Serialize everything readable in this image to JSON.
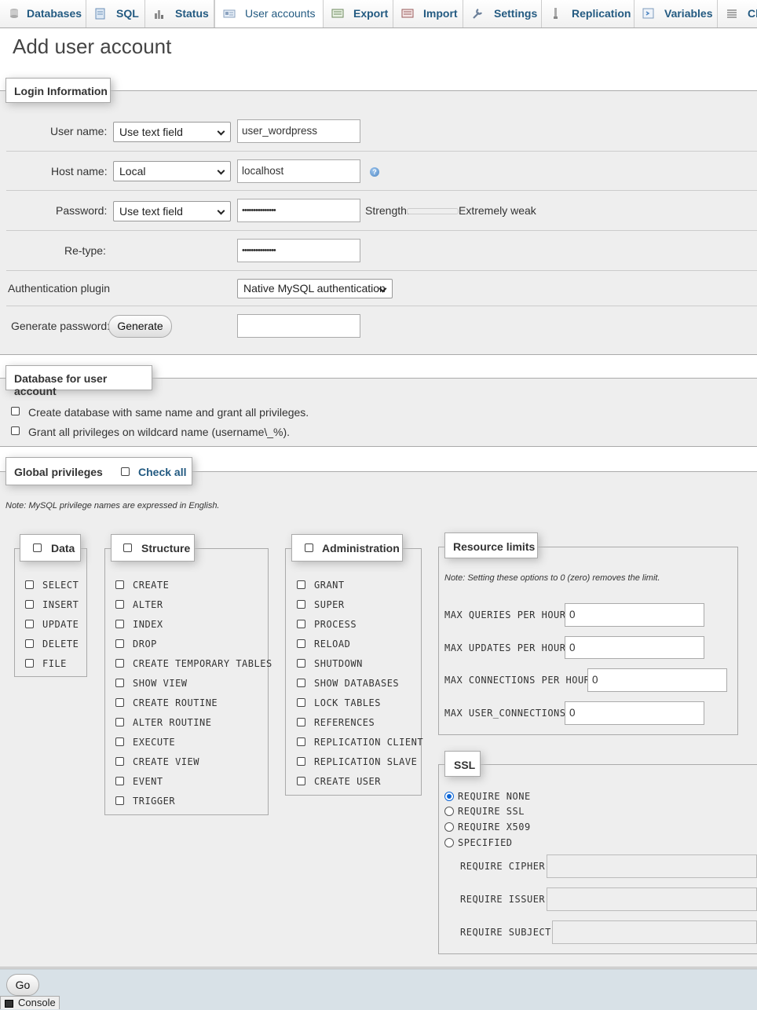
{
  "nav": {
    "tabs": [
      {
        "label": "Databases",
        "icon": "database-icon"
      },
      {
        "label": "SQL",
        "icon": "sql-icon"
      },
      {
        "label": "Status",
        "icon": "status-icon"
      },
      {
        "label": "User accounts",
        "icon": "user-accounts-icon",
        "active": true
      },
      {
        "label": "Export",
        "icon": "export-icon"
      },
      {
        "label": "Import",
        "icon": "import-icon"
      },
      {
        "label": "Settings",
        "icon": "wrench-icon"
      },
      {
        "label": "Replication",
        "icon": "replication-icon"
      },
      {
        "label": "Variables",
        "icon": "variables-icon"
      },
      {
        "label": "Ch",
        "icon": "charsets-icon"
      }
    ]
  },
  "page_title": "Add user account",
  "login": {
    "legend": "Login Information",
    "username_label": "User name:",
    "username_mode": "Use text field",
    "username_value": "user_wordpress",
    "host_label": "Host name:",
    "host_mode": "Local",
    "host_value": "localhost",
    "password_label": "Password:",
    "password_mode": "Use text field",
    "password_mask": "•••••••••••••••",
    "strength_label": "Strength:",
    "strength_value": "Extremely weak",
    "strength_level": 0,
    "retype_label": "Re-type:",
    "retype_mask": "•••••••••••••••",
    "auth_label": "Authentication plugin",
    "auth_value": "Native MySQL authentication",
    "generate_label": "Generate password:",
    "generate_button": "Generate",
    "generated_value": ""
  },
  "database": {
    "legend": "Database for user account",
    "options": [
      "Create database with same name and grant all privileges.",
      "Grant all privileges on wildcard name (username\\_%)."
    ]
  },
  "global": {
    "legend": "Global privileges",
    "check_all": "Check all",
    "note": "Note: MySQL privilege names are expressed in English.",
    "data": {
      "title": "Data",
      "items": [
        "SELECT",
        "INSERT",
        "UPDATE",
        "DELETE",
        "FILE"
      ]
    },
    "structure": {
      "title": "Structure",
      "items": [
        "CREATE",
        "ALTER",
        "INDEX",
        "DROP",
        "CREATE TEMPORARY TABLES",
        "SHOW VIEW",
        "CREATE ROUTINE",
        "ALTER ROUTINE",
        "EXECUTE",
        "CREATE VIEW",
        "EVENT",
        "TRIGGER"
      ]
    },
    "administration": {
      "title": "Administration",
      "items": [
        "GRANT",
        "SUPER",
        "PROCESS",
        "RELOAD",
        "SHUTDOWN",
        "SHOW DATABASES",
        "LOCK TABLES",
        "REFERENCES",
        "REPLICATION CLIENT",
        "REPLICATION SLAVE",
        "CREATE USER"
      ]
    },
    "resources": {
      "title": "Resource limits",
      "note": "Note: Setting these options to 0 (zero) removes the limit.",
      "rows": [
        {
          "label": "MAX QUERIES PER HOUR",
          "value": "0"
        },
        {
          "label": "MAX UPDATES PER HOUR",
          "value": "0"
        },
        {
          "label": "MAX CONNECTIONS PER HOUR",
          "value": "0"
        },
        {
          "label": "MAX USER_CONNECTIONS",
          "value": "0"
        }
      ]
    },
    "ssl": {
      "title": "SSL",
      "options": [
        "REQUIRE NONE",
        "REQUIRE SSL",
        "REQUIRE X509",
        "SPECIFIED"
      ],
      "selected": "REQUIRE NONE",
      "fields": [
        {
          "label": "REQUIRE CIPHER",
          "value": ""
        },
        {
          "label": "REQUIRE ISSUER",
          "value": ""
        },
        {
          "label": "REQUIRE SUBJECT",
          "value": ""
        }
      ]
    }
  },
  "footer": {
    "go": "Go",
    "console": "Console"
  }
}
